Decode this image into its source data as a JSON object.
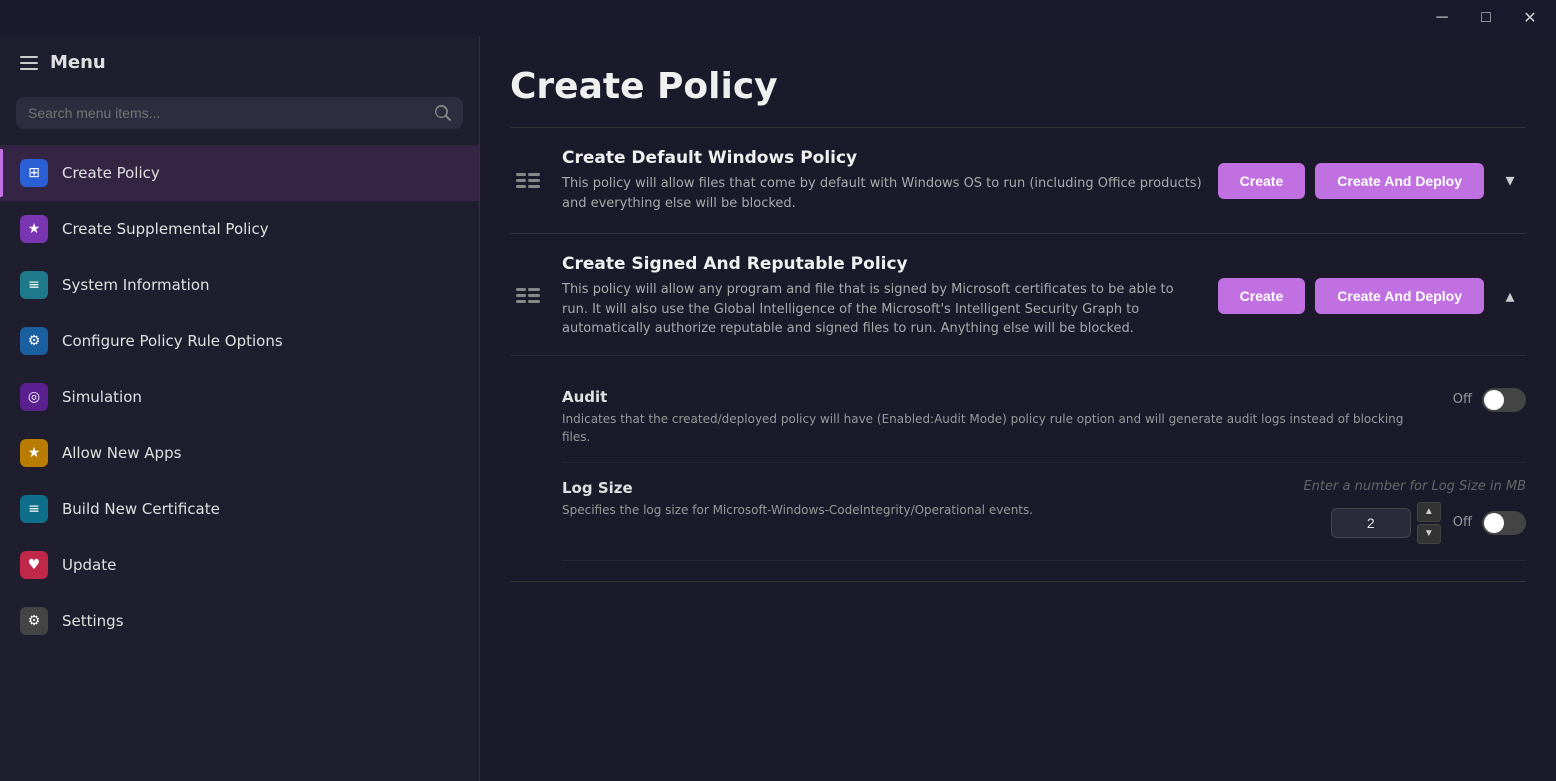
{
  "titleBar": {
    "minimizeLabel": "─",
    "maximizeLabel": "□",
    "closeLabel": "✕"
  },
  "sidebar": {
    "menuLabel": "Menu",
    "searchPlaceholder": "Search menu items...",
    "navItems": [
      {
        "id": "create-policy",
        "label": "Create Policy",
        "iconColor": "icon-blue",
        "iconSymbol": "⊞",
        "active": true
      },
      {
        "id": "create-supplemental",
        "label": "Create Supplemental Policy",
        "iconColor": "icon-purple",
        "iconSymbol": "★",
        "active": false
      },
      {
        "id": "system-information",
        "label": "System Information",
        "iconColor": "icon-teal",
        "iconSymbol": "≡",
        "active": false
      },
      {
        "id": "configure-policy",
        "label": "Configure Policy Rule Options",
        "iconColor": "icon-blue2",
        "iconSymbol": "⚙",
        "active": false
      },
      {
        "id": "simulation",
        "label": "Simulation",
        "iconColor": "icon-violet",
        "iconSymbol": "◎",
        "active": false
      },
      {
        "id": "allow-new-apps",
        "label": "Allow New Apps",
        "iconColor": "icon-gold",
        "iconSymbol": "★",
        "active": false
      },
      {
        "id": "build-certificate",
        "label": "Build New Certificate",
        "iconColor": "icon-cyan",
        "iconSymbol": "≡",
        "active": false
      },
      {
        "id": "update",
        "label": "Update",
        "iconColor": "icon-pink",
        "iconSymbol": "♥",
        "active": false
      },
      {
        "id": "settings",
        "label": "Settings",
        "iconColor": "icon-gray",
        "iconSymbol": "⚙",
        "active": false
      }
    ]
  },
  "mainContent": {
    "pageTitle": "Create Policy",
    "policies": [
      {
        "id": "default-windows",
        "name": "Create Default Windows Policy",
        "description": "This policy will allow files that come by default with Windows OS to run (including Office products) and everything else will be blocked.",
        "createLabel": "Create",
        "createDeployLabel": "Create And Deploy",
        "expanded": false,
        "expandIcon": "▾"
      },
      {
        "id": "signed-reputable",
        "name": "Create Signed And Reputable Policy",
        "description": "This policy will allow any program and file that is signed by Microsoft certificates to be able to run. It will also use the Global Intelligence of the Microsoft's Intelligent Security Graph to automatically authorize reputable and signed files to run. Anything else will be blocked.",
        "createLabel": "Create",
        "createDeployLabel": "Create And Deploy",
        "expanded": true,
        "expandIcon": "▴",
        "settings": [
          {
            "id": "audit",
            "label": "Audit",
            "description": "Indicates that the created/deployed policy will have (Enabled:Audit Mode) policy rule option and will generate audit logs instead of blocking files.",
            "controlType": "toggle",
            "toggleState": "off",
            "toggleOffLabel": "Off"
          },
          {
            "id": "log-size",
            "label": "Log Size",
            "description": "Specifies the log size for Microsoft-Windows-CodeIntegrity/Operational events.",
            "controlType": "number-with-toggle",
            "inputPlaceholder": "Enter a number for Log Size in MB",
            "inputValue": "2",
            "toggleState": "off",
            "toggleOffLabel": "Off"
          }
        ]
      }
    ]
  }
}
